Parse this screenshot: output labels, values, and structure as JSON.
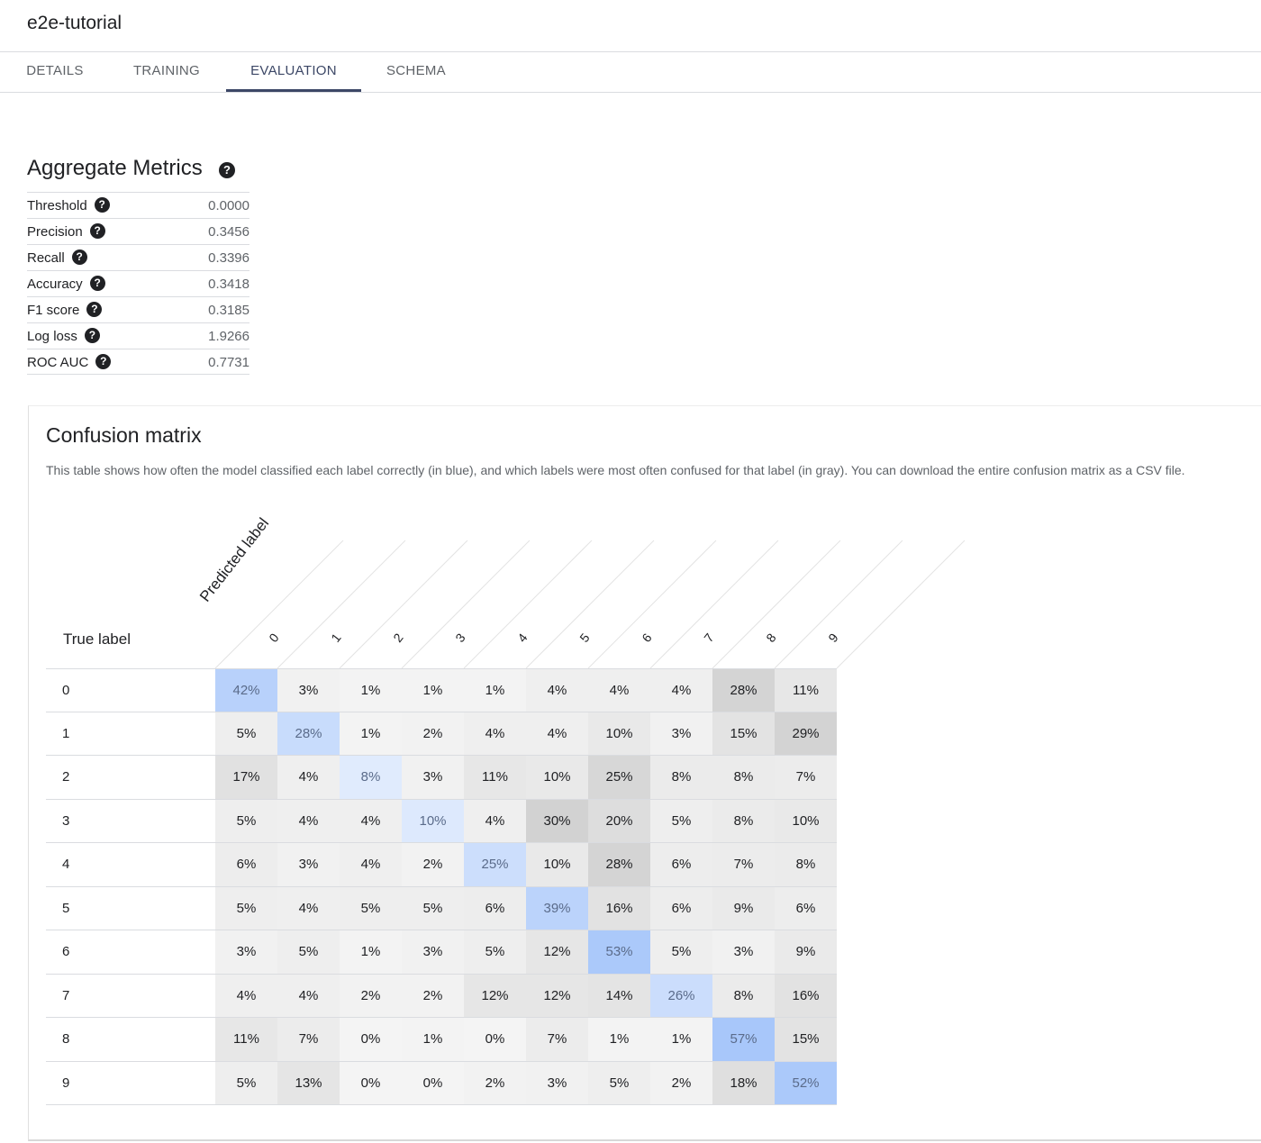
{
  "app": {
    "title": "e2e-tutorial"
  },
  "tabs": [
    {
      "label": "DETAILS",
      "active": false
    },
    {
      "label": "TRAINING",
      "active": false
    },
    {
      "label": "EVALUATION",
      "active": true
    },
    {
      "label": "SCHEMA",
      "active": false
    }
  ],
  "aggregate": {
    "title": "Aggregate Metrics",
    "metrics": [
      {
        "name": "Threshold",
        "value": "0.0000"
      },
      {
        "name": "Precision",
        "value": "0.3456"
      },
      {
        "name": "Recall",
        "value": "0.3396"
      },
      {
        "name": "Accuracy",
        "value": "0.3418"
      },
      {
        "name": "F1 score",
        "value": "0.3185"
      },
      {
        "name": "Log loss",
        "value": "1.9266"
      },
      {
        "name": "ROC AUC",
        "value": "0.7731"
      }
    ]
  },
  "help_icon": "help-circle-icon",
  "confusion": {
    "title": "Confusion matrix",
    "description": "This table shows how often the model classified each label correctly (in blue), and which labels were most often confused for that label (in gray). You can download the entire confusion matrix as a CSV file.",
    "true_label": "True label",
    "predicted_label": "Predicted label",
    "columns": [
      "0",
      "1",
      "2",
      "3",
      "4",
      "5",
      "6",
      "7",
      "8",
      "9"
    ],
    "rows": [
      {
        "label": "0",
        "values": [
          42,
          3,
          1,
          1,
          1,
          4,
          4,
          4,
          28,
          11
        ]
      },
      {
        "label": "1",
        "values": [
          5,
          28,
          1,
          2,
          4,
          4,
          10,
          3,
          15,
          29
        ]
      },
      {
        "label": "2",
        "values": [
          17,
          4,
          8,
          3,
          11,
          10,
          25,
          8,
          8,
          7
        ]
      },
      {
        "label": "3",
        "values": [
          5,
          4,
          4,
          10,
          4,
          30,
          20,
          5,
          8,
          10
        ]
      },
      {
        "label": "4",
        "values": [
          6,
          3,
          4,
          2,
          25,
          10,
          28,
          6,
          7,
          8
        ]
      },
      {
        "label": "5",
        "values": [
          5,
          4,
          5,
          5,
          6,
          39,
          16,
          6,
          9,
          6
        ]
      },
      {
        "label": "6",
        "values": [
          3,
          5,
          1,
          3,
          5,
          12,
          53,
          5,
          3,
          9
        ]
      },
      {
        "label": "7",
        "values": [
          4,
          4,
          2,
          2,
          12,
          12,
          14,
          26,
          8,
          16
        ]
      },
      {
        "label": "8",
        "values": [
          11,
          7,
          0,
          1,
          0,
          7,
          1,
          1,
          57,
          15
        ]
      },
      {
        "label": "9",
        "values": [
          5,
          13,
          0,
          0,
          2,
          3,
          5,
          2,
          18,
          52
        ]
      }
    ],
    "correct_color": "#a8c7fa",
    "confused_color": "#bdbdbd"
  }
}
